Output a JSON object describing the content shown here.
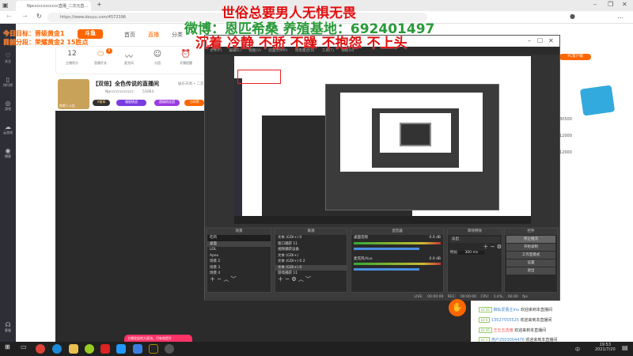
{
  "browser": {
    "tab_title": "Npcccccccccccc直播_二次元直...",
    "url": "https://www.douyu.com/4572396",
    "new_tab": "+"
  },
  "overlay": {
    "goal": "今日目标：晋级黄金1",
    "rank": "目前分段：荣耀黄金2 15胜点",
    "line1": "世俗总要男人无惧无畏",
    "line2": "微博：恩匹希桑 养殖基地：692401497",
    "line3": "沉着 冷静 不骄 不躁 不抱怨 不上头"
  },
  "site": {
    "logo": "斗鱼",
    "nav": [
      "首页",
      "直播",
      "分类"
    ]
  },
  "sidebar": {
    "items": [
      "关注",
      "排行榜",
      "游戏",
      "云游戏",
      "播客"
    ],
    "bottom": "客服"
  },
  "stats": {
    "score": "12",
    "score_label": "主播积分",
    "items": [
      "直播开关",
      "麦克风",
      "分团",
      "开播提醒"
    ],
    "badge": "8"
  },
  "streamer": {
    "title": "【双倍】全色传说的直播间",
    "category": "娱乐天地 • 二次元",
    "name": "Npcccccccccccc",
    "hot": "51063",
    "avatar_label": "鱼吧 | 公告",
    "tags": [
      "V徽章",
      "福星挑战",
      "超级粉丝团",
      "小时榜"
    ]
  },
  "obs": {
    "menu": [
      "文件(F)",
      "编辑(E)",
      "视图(V)",
      "配置文件(P)",
      "场景集合(S)",
      "工具(T)",
      "帮助(H)"
    ],
    "scenes_header": "场景",
    "scenes": [
      "吃鸡",
      "桌面",
      "LOL",
      "Apex",
      "场景 2",
      "场景 3",
      "场景 4"
    ],
    "sources_header": "来源",
    "sources": [
      "文本 (GDI+) 0",
      "窗口捕获 11",
      "视频捕获设备",
      "文本 (GDI+)",
      "文本 (GDI+) 0 2",
      "文本 (GDI+) 0",
      "游戏捕获 11"
    ],
    "mixer_header": "混音器",
    "mixer": [
      {
        "name": "桌面音频",
        "db": "0.0 dB"
      },
      {
        "name": "麦克风/Aux",
        "db": "0.0 dB"
      }
    ],
    "transitions_header": "转场特效",
    "transition": "淡出",
    "duration_label": "时长",
    "duration": "300 ms",
    "controls_header": "控件",
    "controls": [
      "停止推流",
      "开始录制",
      "工作室模式",
      "设置",
      "退出"
    ],
    "status": {
      "live": "LIVE: 00:00:00",
      "rec": "REC: 00:00:00",
      "cpu": "CPU: 1.4%, 60.00 fps"
    }
  },
  "ranking": {
    "client_btn": "PC客户端",
    "values": [
      "30500",
      "12000",
      "12000"
    ]
  },
  "chat": [
    {
      "lv": "LV 32",
      "user": "御仙爱蕾主Inu",
      "msg": "欢迎来到本直播间"
    },
    {
      "lv": "LV 6",
      "user": "13527555525",
      "msg": "欢迎来到本直播间"
    },
    {
      "lv": "LV 45",
      "user": "王五五选魂",
      "msg": "欢迎来到本直播间"
    },
    {
      "lv": "LV 1",
      "user": "用户2503004476",
      "msg": "欢迎来到本直播间"
    }
  ],
  "toast": "主播发起的大屏流，可有效提升",
  "taskbar": {
    "time": "19:53",
    "date": "2021/7/20",
    "ime": "中"
  }
}
